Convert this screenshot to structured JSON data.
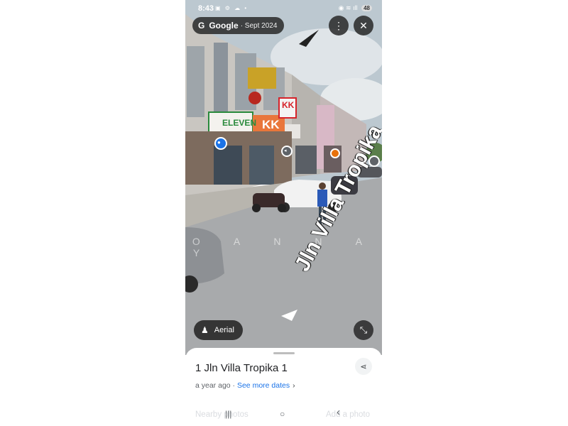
{
  "status_bar": {
    "time": "8:43",
    "left_icons": "▣ ⚙ ☁ •",
    "right_icons": "◉ ≋ ıll",
    "battery": "48"
  },
  "header": {
    "google_glyph": "G",
    "brand": "Google",
    "date": "· Sept 2024"
  },
  "street_view": {
    "road_label": "Jln Villa Tropika",
    "shop_signs": {
      "seven_eleven": "ELEVEN",
      "kk": "KK",
      "kk_small": "KK"
    },
    "watermark": "J O A N N A   T Y"
  },
  "controls": {
    "aerial_label": "Aerial",
    "menu_icon": "⋮",
    "close_icon": "✕",
    "collapse_icon": "⤡"
  },
  "place": {
    "title": "1 Jln Villa Tropika 1",
    "age": "a year ago",
    "separator": " · ",
    "see_more": "See more dates",
    "chevron": "›",
    "nearby_photos": "Nearby photos",
    "add_photo": "Add a photo"
  },
  "system_nav": {
    "recents": "|||",
    "home": "○",
    "back": "‹"
  },
  "colors": {
    "accent": "#1a73e8",
    "sky": "#b9c6cf",
    "road": "#a9abad",
    "dark_pill": "#282828"
  }
}
